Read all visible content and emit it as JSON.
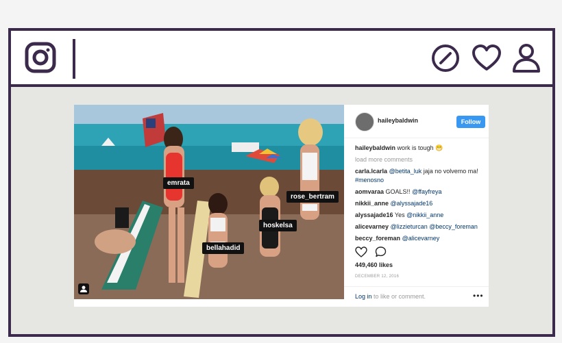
{
  "app": {
    "brand_icon": "instagram-logo-icon",
    "accent": "#3b2a4b"
  },
  "nav": {
    "icons": [
      "explore-icon",
      "heart-icon",
      "profile-icon"
    ]
  },
  "post": {
    "username": "haileybaldwin",
    "follow_label": "Follow",
    "tags": [
      "emrata",
      "rose_bertram",
      "hoskelsa",
      "bellahadid"
    ],
    "caption": {
      "user": "haileybaldwin",
      "text": "work is tough",
      "emoji": "😁"
    },
    "load_more": "load more comments",
    "comments": [
      {
        "user": "carla.lcarla",
        "pre": "",
        "mention": "@betita_luk",
        "post": " jaja no volvemo ma! ",
        "mention2": "#menosno"
      },
      {
        "user": "aomvaraa",
        "pre": "GOALS!! ",
        "mention": "@ffayfreya",
        "post": "",
        "mention2": ""
      },
      {
        "user": "nikkii_anne",
        "pre": "",
        "mention": "@alyssajade16",
        "post": "",
        "mention2": ""
      },
      {
        "user": "alyssajade16",
        "pre": "Yes ",
        "mention": "@nikkii_anne",
        "post": "",
        "mention2": ""
      },
      {
        "user": "alicevarney",
        "pre": "",
        "mention": "@lizzieturcan",
        "post": " ",
        "mention2": "@beccy_foreman"
      },
      {
        "user": "beccy_foreman",
        "pre": "",
        "mention": "@alicevarney",
        "post": "",
        "mention2": ""
      }
    ],
    "likes": "449,460 likes",
    "date": "DECEMBER 12, 2016",
    "login": {
      "link": "Log in",
      "rest": " to like or comment."
    },
    "more": "•••"
  },
  "colors": {
    "follow": "#3897f0",
    "link": "#003569",
    "muted": "#999999"
  }
}
